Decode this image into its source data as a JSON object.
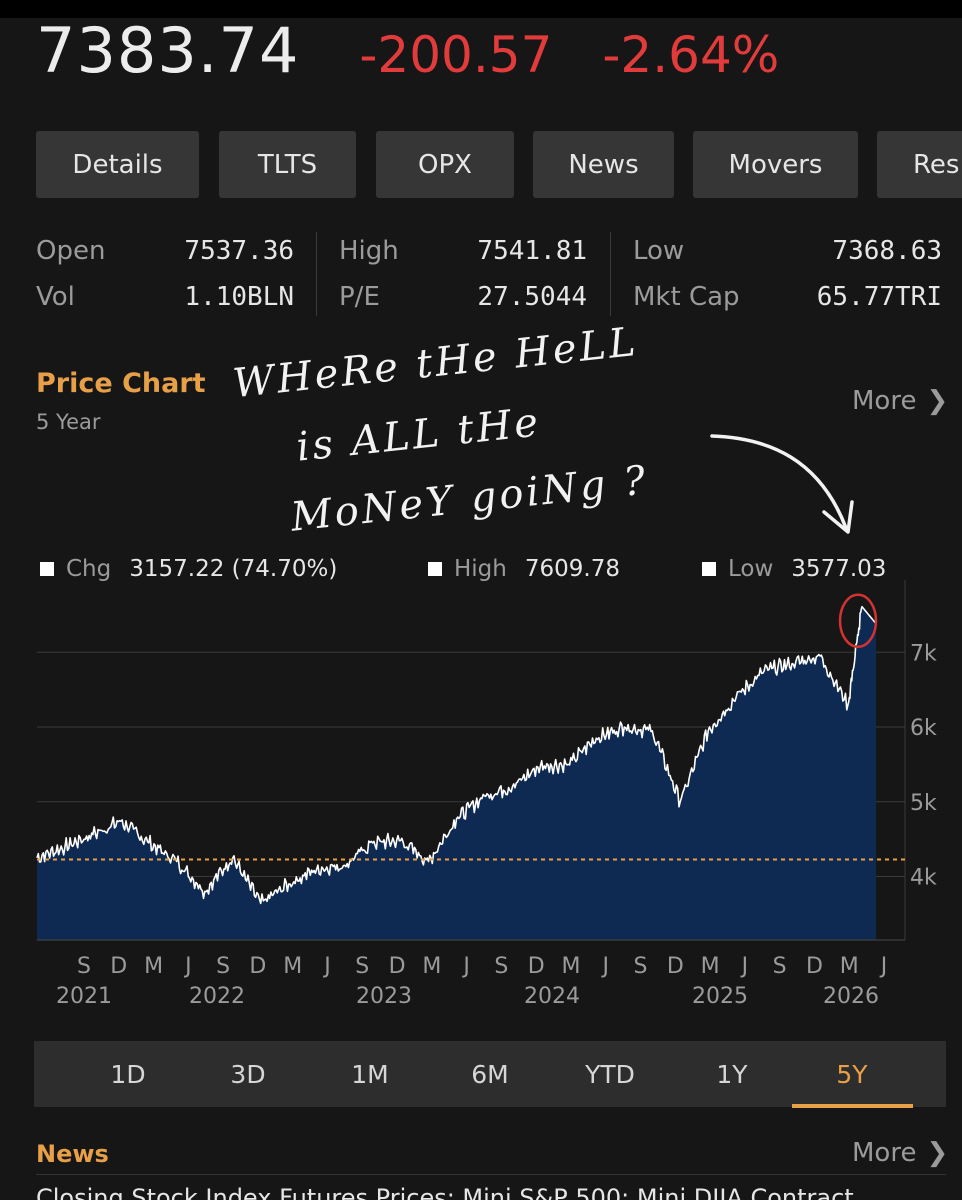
{
  "quote": {
    "price": "7383.74",
    "change": "-200.57",
    "change_pct": "-2.64%"
  },
  "tabs": [
    "Details",
    "TLTS",
    "OPX",
    "News",
    "Movers",
    "Res"
  ],
  "stats": {
    "open_label": "Open",
    "open": "7537.36",
    "high_label": "High",
    "high": "7541.81",
    "low_label": "Low",
    "low": "7368.63",
    "vol_label": "Vol",
    "vol": "1.10BLN",
    "pe_label": "P/E",
    "pe": "27.5044",
    "mktcap_label": "Mkt Cap",
    "mktcap": "65.77TRI"
  },
  "price_chart": {
    "title": "Price Chart",
    "subtitle": "5 Year",
    "more": "More",
    "annotation": [
      "WHeRe tHe HeLL",
      "is ALL tHe",
      "MoNeY goiNg ?"
    ]
  },
  "legend": {
    "chg_label": "Chg",
    "chg_value": "3157.22 (74.70%)",
    "high_label": "High",
    "high_value": "7609.78",
    "low_label": "Low",
    "low_value": "3577.03"
  },
  "colors": {
    "accent": "#e8a048",
    "negative": "#e23b3b",
    "area_fill": "#0e2a52",
    "line": "#ffffff",
    "baseline": "#e8a048",
    "annotation_circle": "#d23232"
  },
  "chart_data": {
    "type": "area",
    "title": "",
    "xlabel": "",
    "ylabel": "",
    "ylim": [
      3150,
      7700
    ],
    "yticks": [
      4000,
      5000,
      6000,
      7000
    ],
    "ytick_labels": [
      "7k",
      "6k",
      "5k",
      "4k"
    ],
    "reference_line": 4226.52,
    "x_month_labels": [
      "S",
      "D",
      "M",
      "J",
      "S",
      "D",
      "M",
      "J",
      "S",
      "D",
      "M",
      "J",
      "S",
      "D",
      "M",
      "J",
      "S",
      "D",
      "M",
      "J",
      "S",
      "D",
      "M",
      "J"
    ],
    "x_year_labels": [
      "2021",
      "2022",
      "2023",
      "2024",
      "2025",
      "2026"
    ],
    "x": [
      "2021-06",
      "2021-08",
      "2021-10",
      "2021-12",
      "2022-02",
      "2022-04",
      "2022-06",
      "2022-08",
      "2022-10",
      "2022-12",
      "2023-02",
      "2023-04",
      "2023-06",
      "2023-08",
      "2023-10",
      "2023-12",
      "2024-02",
      "2024-04",
      "2024-06",
      "2024-08",
      "2024-10",
      "2024-12",
      "2025-02",
      "2025-04",
      "2025-06",
      "2025-08",
      "2025-10",
      "2025-12",
      "2026-02",
      "2026-04",
      "2026-05",
      "2026-06"
    ],
    "values": [
      4250,
      4400,
      4560,
      4740,
      4450,
      4200,
      3800,
      4250,
      3640,
      3900,
      4100,
      4150,
      4450,
      4480,
      4200,
      4770,
      5080,
      5200,
      5480,
      5500,
      5850,
      6000,
      5950,
      5000,
      5950,
      6400,
      6750,
      6850,
      6950,
      6300,
      7609.78,
      7383.74
    ],
    "stats": {
      "chg": "3157.22 (74.70%)",
      "high": 7609.78,
      "low": 3577.03
    }
  },
  "ranges": [
    "1D",
    "3D",
    "1M",
    "6M",
    "YTD",
    "1Y",
    "5Y"
  ],
  "active_range": "5Y",
  "news": {
    "title": "News",
    "more": "More",
    "headline": "Closing Stock Index Futures Prices: Mini S&P 500; Mini DJIA Contract"
  }
}
